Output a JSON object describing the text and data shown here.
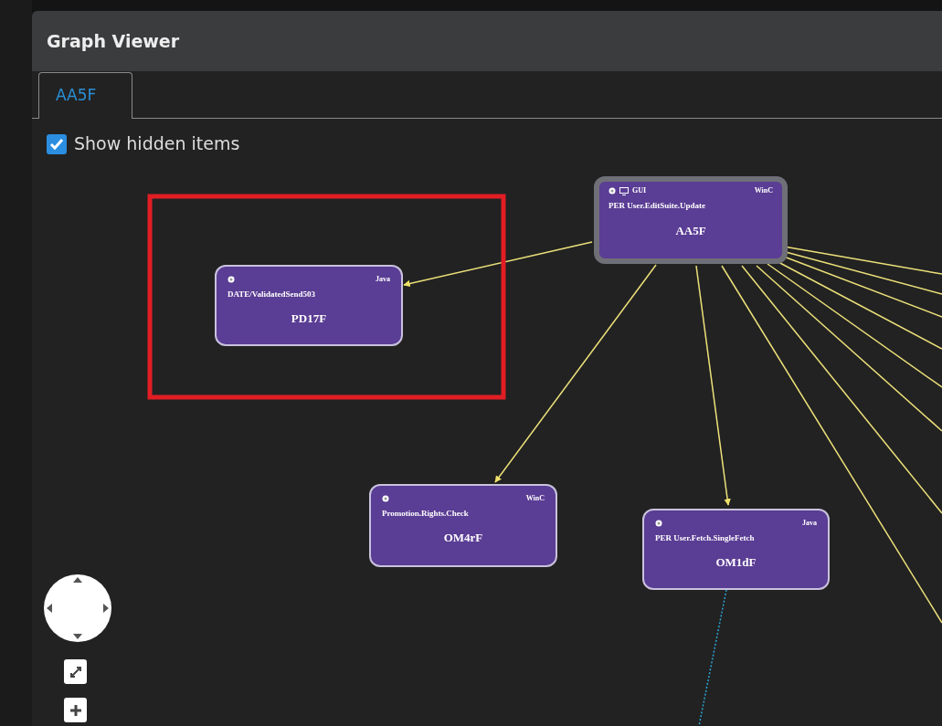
{
  "window": {
    "title": "Graph Viewer"
  },
  "tabs": [
    {
      "label": "AA5F",
      "selected": true
    }
  ],
  "show_hidden": {
    "label": "Show hidden items",
    "checked": true
  },
  "nodes": [
    {
      "kind": "gui",
      "type": "GUI",
      "platform": "WinC",
      "path": "PER User.EditSuite.Update",
      "name": "AA5F",
      "selected": true
    },
    {
      "kind": "service",
      "platform": "Java",
      "path": "DATE/ValidatedSend503",
      "name": "PD17F",
      "selected": false
    },
    {
      "kind": "service",
      "platform": "WinC",
      "path": "Promotion.Rights.Check",
      "name": "OM4rF",
      "selected": false
    },
    {
      "kind": "service",
      "platform": "Java",
      "path": "PER User.Fetch.SingleFetch",
      "name": "OM1dF",
      "selected": false
    }
  ]
}
